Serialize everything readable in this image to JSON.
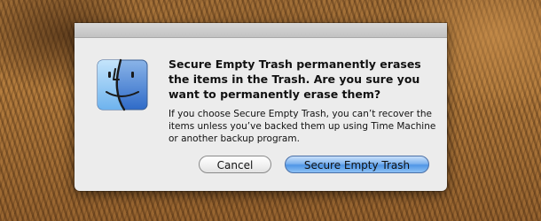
{
  "dialog": {
    "icon": "finder-icon",
    "title": "Secure Empty Trash permanently erases the items in the Trash. Are you sure you want to permanently erase them?",
    "message": "If you choose Secure Empty Trash, you can’t recover the items unless you’ve backed them up using Time Machine or another backup program.",
    "buttons": {
      "cancel_label": "Cancel",
      "confirm_label": "Secure Empty Trash"
    }
  },
  "colors": {
    "dialog_background": "#ececec",
    "default_button": "#5d9ee8"
  }
}
